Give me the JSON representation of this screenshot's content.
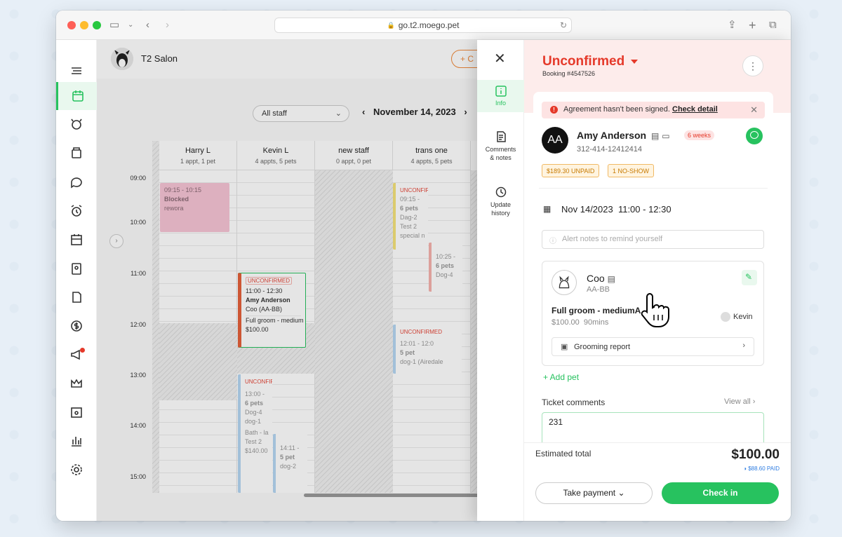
{
  "browser": {
    "url": "go.t2.moego.pet"
  },
  "header": {
    "salon_name": "T2 Salon",
    "add_button_label": "+ C"
  },
  "calendar": {
    "staff_filter": "All staff",
    "date": "November 14, 2023",
    "times": [
      "09:00",
      "10:00",
      "11:00",
      "12:00",
      "13:00",
      "14:00",
      "15:00"
    ],
    "columns": [
      {
        "name": "Harry L",
        "summary": "1 appt, 1 pet"
      },
      {
        "name": "Kevin L",
        "summary": "4 appts, 5 pets"
      },
      {
        "name": "new staff",
        "summary": "0 appt, 0 pet"
      },
      {
        "name": "trans one",
        "summary": "4 appts, 5 pets"
      }
    ],
    "blocked": {
      "time": "09:15 - 10:15",
      "title": "Blocked",
      "note": "rewora"
    },
    "selected_appt": {
      "tag": "UNCONFIRMED",
      "time": "11:00 - 12:30",
      "customer": "Amy Anderson",
      "pet": "Coo",
      "breed": "(AA-BB)",
      "service": "Full groom - medium",
      "price": "$100.00"
    },
    "appt_trans1": {
      "tag": "UNCONFIRMED",
      "time": "09:15 -",
      "pets": "6 pets",
      "pet": "Dag-2",
      "note": "Test 2",
      "extra": "special n"
    },
    "appt_trans2": {
      "time": "10:25 -",
      "pets": "6 pets",
      "pet": "Dog-4"
    },
    "appt_trans3": {
      "tag": "UNCONFIRMED",
      "time": "12:01 - 12:0",
      "pets": "5 pet",
      "pet": "dog-1 (Airedale"
    },
    "appt_kevin2": {
      "tag": "UNCONFIRMED",
      "time": "13:00 -",
      "pets": "6 pets",
      "pet": "Dog-4",
      "pet2": "dog-1",
      "svc": "Bath - la",
      "note": "Test 2",
      "price": "$140.00"
    },
    "appt_kevin3": {
      "time": "14:11 -",
      "pets": "5 pet",
      "pet": "dog-2"
    }
  },
  "panel": {
    "tabs": [
      {
        "label": "Info"
      },
      {
        "label": "Comments & notes"
      },
      {
        "label": "Update history"
      }
    ],
    "status": "Unconfirmed",
    "booking_no": "Booking #4547526",
    "alert_text": "Agreement hasn't been signed.",
    "alert_link": "Check detail",
    "customer": {
      "initials": "AA",
      "name": "Amy Anderson",
      "phone": "312-414-12412414",
      "frequency": "6 weeks"
    },
    "badges": {
      "unpaid": "$189.30 UNPAID",
      "noshow": "1 NO-SHOW"
    },
    "appointment_time": "Nov 14/2023  11:00 - 12:30",
    "alert_notes_placeholder": "Alert notes to remind yourself",
    "pet": {
      "name": "Coo",
      "breed": "AA-BB",
      "service": "Full groom - mediumA",
      "price": "$100.00",
      "duration": "90mins",
      "staff": "Kevin",
      "report": "Grooming report"
    },
    "add_pet": "+ Add pet",
    "ticket_comments_label": "Ticket comments",
    "view_all": "View all",
    "ticket_comment": "231",
    "estimated_total_label": "Estimated total",
    "estimated_total": "$100.00",
    "paid": "$88.60 PAID",
    "take_payment": "Take payment",
    "check_in": "Check in"
  },
  "colors": {
    "accent": "#27c25f",
    "danger": "#e5392a"
  }
}
